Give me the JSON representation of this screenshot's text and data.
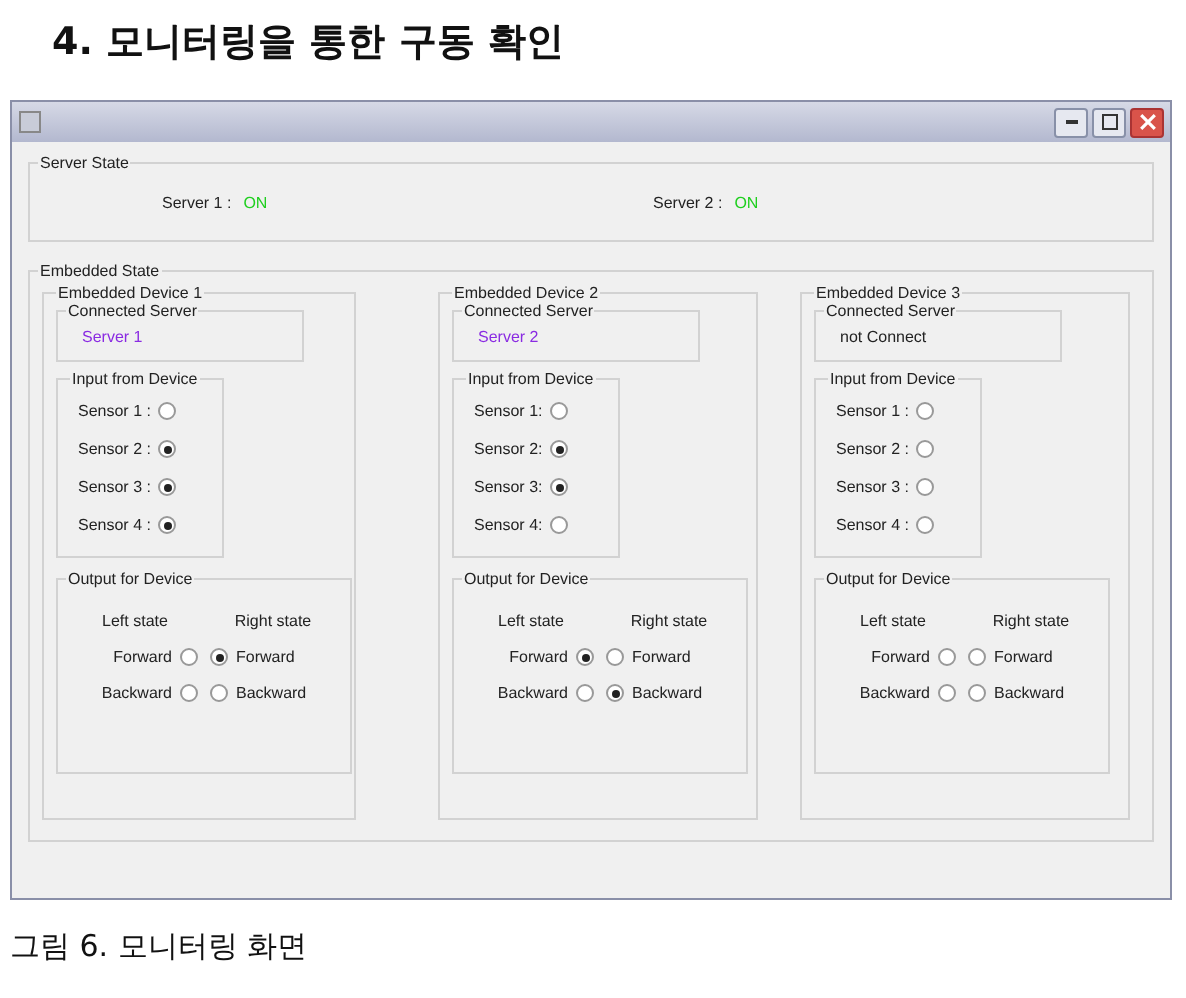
{
  "heading": "4. 모니터링을 통한 구동 확인",
  "window": {
    "server_state": {
      "title": "Server State",
      "servers": [
        {
          "label": "Server 1 :",
          "value": "ON"
        },
        {
          "label": "Server 2 :",
          "value": "ON"
        }
      ]
    },
    "embedded_state": {
      "title": "Embedded State",
      "devices": [
        {
          "title": "Embedded Device 1",
          "connected_server": {
            "title": "Connected Server",
            "value": "Server 1",
            "kind": "server"
          },
          "input": {
            "title": "Input from Device",
            "sensors": [
              {
                "label": "Sensor 1 :",
                "selected": false
              },
              {
                "label": "Sensor 2 :",
                "selected": true
              },
              {
                "label": "Sensor 3 :",
                "selected": true
              },
              {
                "label": "Sensor 4 :",
                "selected": true
              }
            ]
          },
          "output": {
            "title": "Output for Device",
            "left_header": "Left state",
            "right_header": "Right state",
            "rows": [
              {
                "left": {
                  "label": "Forward",
                  "selected": false
                },
                "right": {
                  "label": "Forward",
                  "selected": true
                }
              },
              {
                "left": {
                  "label": "Backward",
                  "selected": false
                },
                "right": {
                  "label": "Backward",
                  "selected": false
                }
              }
            ]
          }
        },
        {
          "title": "Embedded Device 2",
          "connected_server": {
            "title": "Connected Server",
            "value": "Server 2",
            "kind": "server"
          },
          "input": {
            "title": "Input from Device",
            "sensors": [
              {
                "label": "Sensor 1:",
                "selected": false
              },
              {
                "label": "Sensor 2:",
                "selected": true
              },
              {
                "label": "Sensor 3:",
                "selected": true
              },
              {
                "label": "Sensor 4:",
                "selected": false
              }
            ]
          },
          "output": {
            "title": "Output for Device",
            "left_header": "Left state",
            "right_header": "Right state",
            "rows": [
              {
                "left": {
                  "label": "Forward",
                  "selected": true
                },
                "right": {
                  "label": "Forward",
                  "selected": false
                }
              },
              {
                "left": {
                  "label": "Backward",
                  "selected": false
                },
                "right": {
                  "label": "Backward",
                  "selected": true
                }
              }
            ]
          }
        },
        {
          "title": "Embedded Device 3",
          "connected_server": {
            "title": "Connected Server",
            "value": "not Connect",
            "kind": "none"
          },
          "input": {
            "title": "Input from Device",
            "sensors": [
              {
                "label": "Sensor 1 :",
                "selected": false
              },
              {
                "label": "Sensor 2 :",
                "selected": false
              },
              {
                "label": "Sensor 3 :",
                "selected": false
              },
              {
                "label": "Sensor 4 :",
                "selected": false
              }
            ]
          },
          "output": {
            "title": "Output for Device",
            "left_header": "Left state",
            "right_header": "Right state",
            "rows": [
              {
                "left": {
                  "label": "Forward",
                  "selected": false
                },
                "right": {
                  "label": "Forward",
                  "selected": false
                }
              },
              {
                "left": {
                  "label": "Backward",
                  "selected": false
                },
                "right": {
                  "label": "Backward",
                  "selected": false
                }
              }
            ]
          }
        }
      ]
    }
  },
  "caption": "그림 6. 모니터링 화면"
}
